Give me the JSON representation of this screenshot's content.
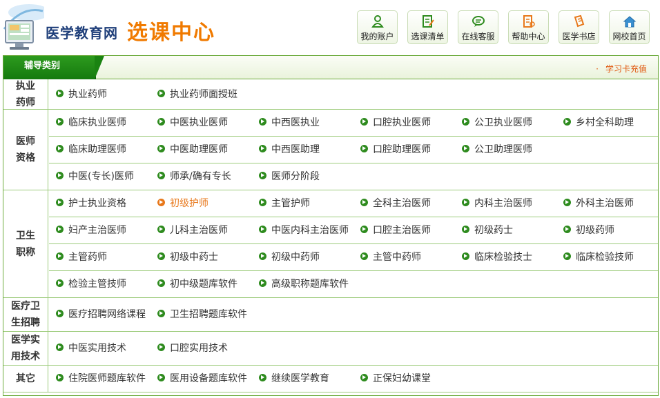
{
  "header": {
    "site_name": "医学教育网",
    "site_sub": "选课中心",
    "nav": [
      {
        "label": "我的账户",
        "icon": "user-icon"
      },
      {
        "label": "选课清单",
        "icon": "list-icon"
      },
      {
        "label": "在线客服",
        "icon": "chat-icon"
      },
      {
        "label": "帮助中心",
        "icon": "help-icon"
      },
      {
        "label": "医学书店",
        "icon": "book-icon"
      },
      {
        "label": "网校首页",
        "icon": "home-icon"
      }
    ]
  },
  "panel": {
    "tab_label": "辅导类别",
    "recharge_label": "学习卡充值",
    "colors": {
      "accent": "#2d9a1e",
      "active": "#e8781b",
      "link": "#e0550b"
    },
    "groups": [
      {
        "lines": [
          "执业",
          "药师"
        ],
        "rows": [
          [
            "执业药师",
            "执业药师面授班"
          ]
        ]
      },
      {
        "lines": [
          "医师",
          "资格"
        ],
        "rows": [
          [
            "临床执业医师",
            "中医执业医师",
            "中西医执业",
            "口腔执业医师",
            "公卫执业医师",
            "乡村全科助理"
          ],
          [
            "临床助理医师",
            "中医助理医师",
            "中西医助理",
            "口腔助理医师",
            "公卫助理医师"
          ],
          [
            "中医(专长)医师",
            "师承/确有专长",
            "医师分阶段"
          ]
        ]
      },
      {
        "lines": [
          "卫生",
          "职称"
        ],
        "rows": [
          [
            "护士执业资格",
            "初级护师",
            "主管护师",
            "全科主治医师",
            "内科主治医师",
            "外科主治医师"
          ],
          [
            "妇产主治医师",
            "儿科主治医师",
            "中医内科主治医师",
            "口腔主治医师",
            "初级药士",
            "初级药师"
          ],
          [
            "主管药师",
            "初级中药士",
            "初级中药师",
            "主管中药师",
            "临床检验技士",
            "临床检验技师"
          ],
          [
            "检验主管技师",
            "初中级题库软件",
            "高级职称题库软件"
          ]
        ]
      },
      {
        "lines": [
          "医疗卫",
          "生招聘"
        ],
        "rows": [
          [
            "医疗招聘网络课程",
            "卫生招聘题库软件"
          ]
        ]
      },
      {
        "lines": [
          "医学实",
          "用技术"
        ],
        "rows": [
          [
            "中医实用技术",
            "口腔实用技术"
          ]
        ]
      },
      {
        "lines": [
          "其它"
        ],
        "rows": [
          [
            "住院医师题库软件",
            "医用设备题库软件",
            "继续医学教育",
            "正保妇幼课堂"
          ]
        ]
      }
    ]
  }
}
